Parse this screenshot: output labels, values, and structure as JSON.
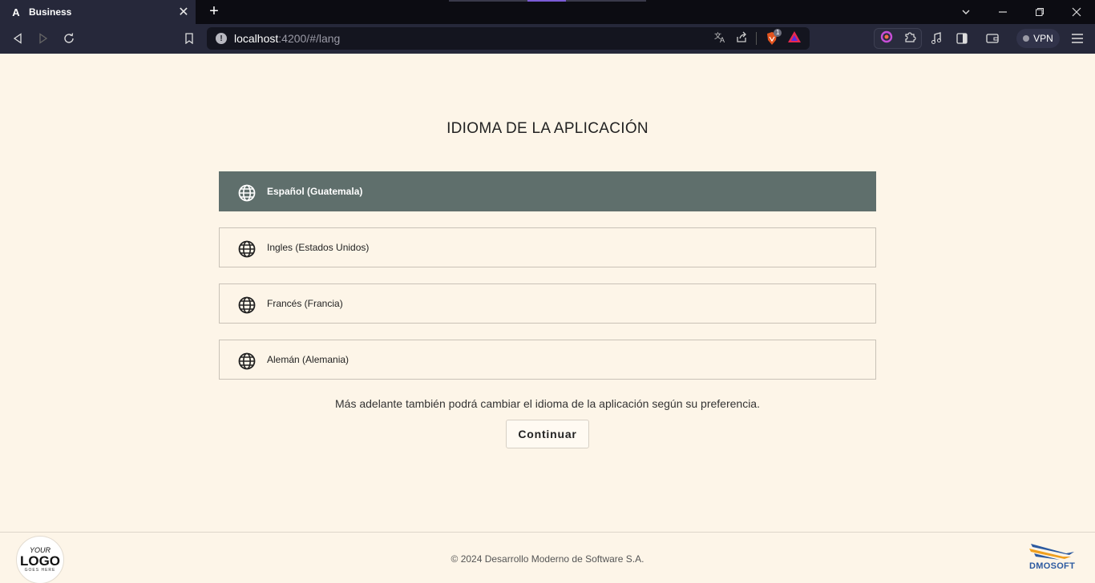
{
  "browser": {
    "tab_title": "Business",
    "tab_favicon": "A",
    "url_host": "localhost",
    "url_path": ":4200/#/lang",
    "vpn_label": "VPN",
    "brave_badge": "1"
  },
  "page": {
    "title": "IDIOMA DE LA APLICACIÓN",
    "languages": [
      {
        "label": "Español (Guatemala)",
        "selected": true
      },
      {
        "label": "Ingles (Estados Unidos)",
        "selected": false
      },
      {
        "label": "Francés (Francia)",
        "selected": false
      },
      {
        "label": "Alemán (Alemania)",
        "selected": false
      }
    ],
    "note": "Más adelante también podrá cambiar el idioma de la aplicación según su preferencia.",
    "continue_label": "Continuar"
  },
  "footer": {
    "logo_top": "YOUR",
    "logo_main": "LOGO",
    "logo_bottom": "GOES HERE",
    "copyright": "© 2024 Desarrollo Moderno de Software S.A.",
    "brand": "DMOSOFT"
  },
  "icons": {
    "language_option": "globe-icon"
  },
  "colors": {
    "page_background": "#fdf5e8",
    "selected_option": "#5f6f6c",
    "chrome_dark": "#0c0c12",
    "chrome_toolbar": "#26283a",
    "brand_blue": "#2c5aa0"
  }
}
